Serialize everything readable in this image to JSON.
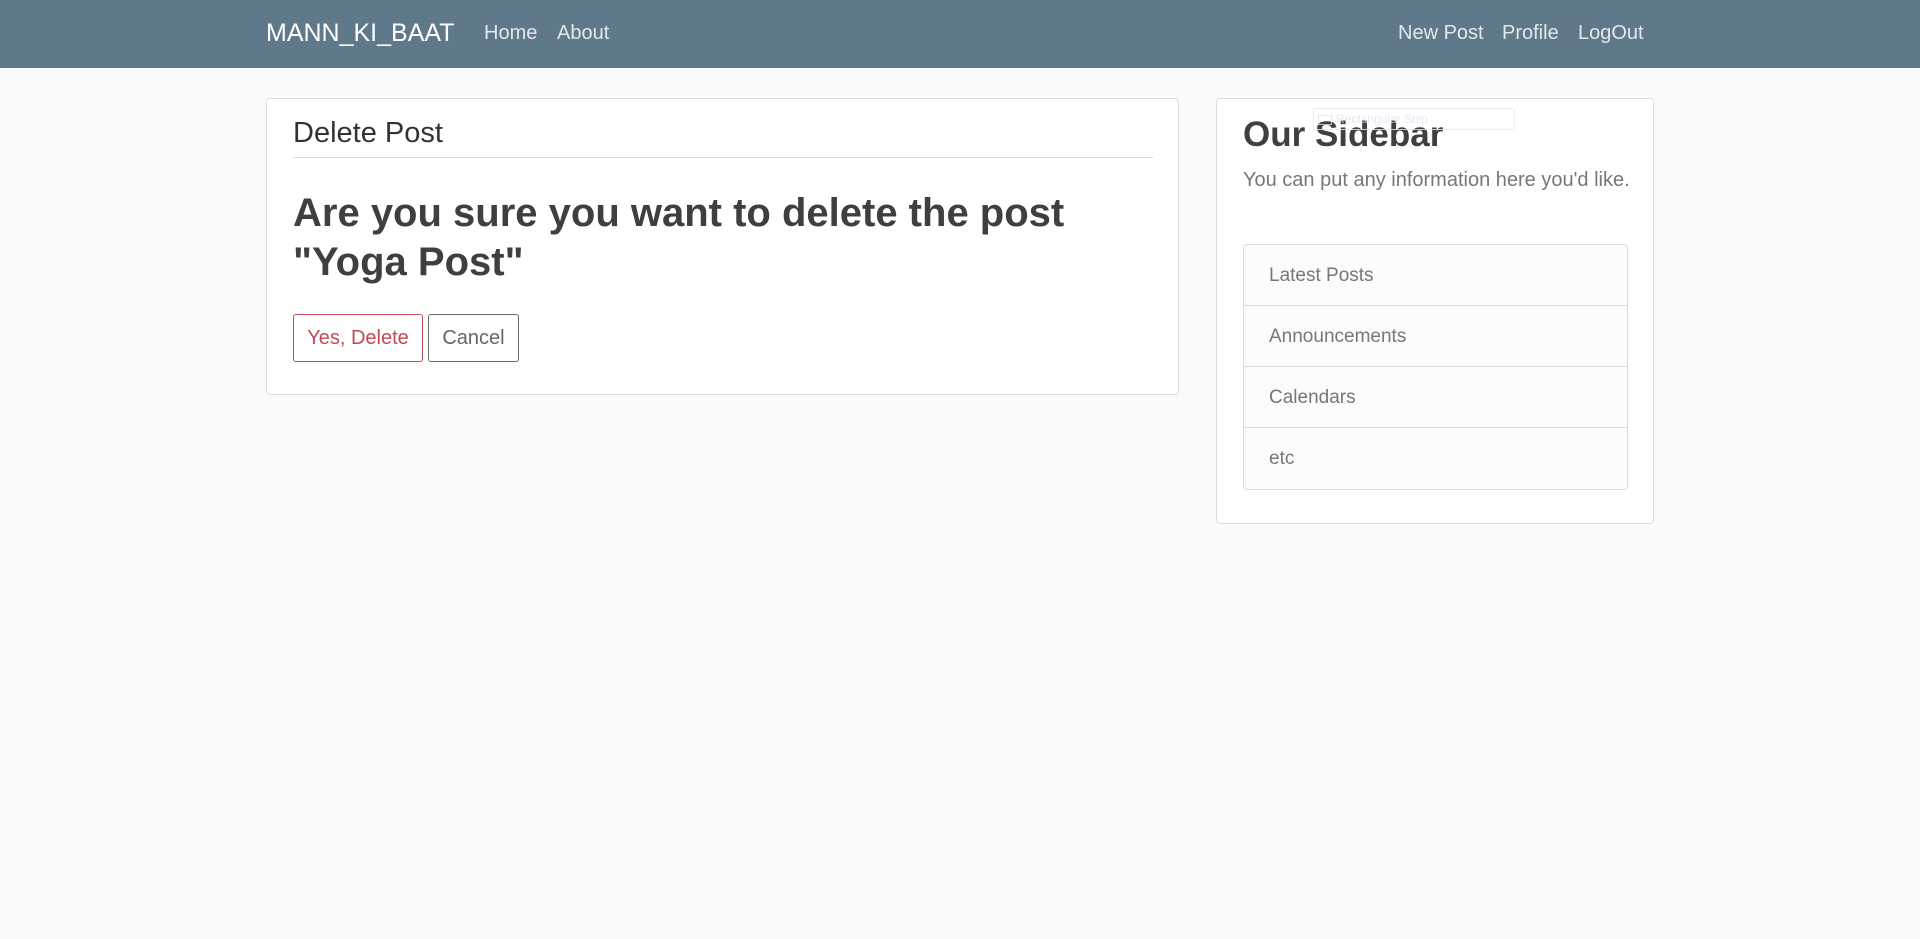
{
  "nav": {
    "brand": "MANN_KI_BAAT",
    "left_links": [
      "Home",
      "About"
    ],
    "right_links": [
      "New Post",
      "Profile",
      "LogOut"
    ]
  },
  "main": {
    "legend": "Delete Post",
    "confirm_text": "Are you sure you want to delete the post \"Yoga Post\"",
    "delete_button": "Yes, Delete",
    "cancel_button": "Cancel"
  },
  "sidebar": {
    "title": "Our Sidebar",
    "text": "You can put any information here you'd like.",
    "items": [
      "Latest Posts",
      "Announcements",
      "Calendars",
      "etc"
    ]
  },
  "overlay": {
    "snip_label": "Rectangular Snip"
  },
  "colors": {
    "navbar": "#5f788a",
    "background": "#fafafa",
    "danger": "#c14a55"
  }
}
